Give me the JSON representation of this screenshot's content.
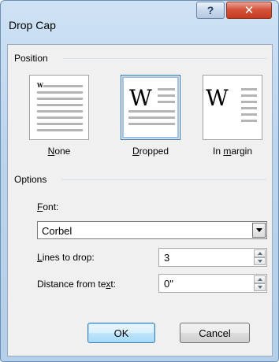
{
  "window": {
    "title": "Drop Cap",
    "help_glyph": "?",
    "close_glyph": "✕"
  },
  "position": {
    "group_label": "Position",
    "options": [
      {
        "label_prefix": "",
        "label_accel": "N",
        "label_rest": "one",
        "letter": "W",
        "selected": false
      },
      {
        "label_prefix": "",
        "label_accel": "D",
        "label_rest": "ropped",
        "letter": "W",
        "selected": true
      },
      {
        "label_prefix": "In ",
        "label_accel": "m",
        "label_rest": "argin",
        "letter": "W",
        "selected": false
      }
    ]
  },
  "options": {
    "group_label": "Options",
    "font": {
      "label_accel": "F",
      "label_rest": "ont:",
      "value": "Corbel"
    },
    "lines_to_drop": {
      "label_accel": "L",
      "label_rest": "ines to drop:",
      "value": "3"
    },
    "distance": {
      "label_prefix": "Distance from te",
      "label_accel": "x",
      "label_rest": "t:",
      "value": "0\""
    }
  },
  "buttons": {
    "ok": "OK",
    "cancel": "Cancel"
  },
  "colors": {
    "selected_border": "#2f6cb0",
    "title_bar": "#bcd5ef",
    "close_button": "#c43a20"
  }
}
